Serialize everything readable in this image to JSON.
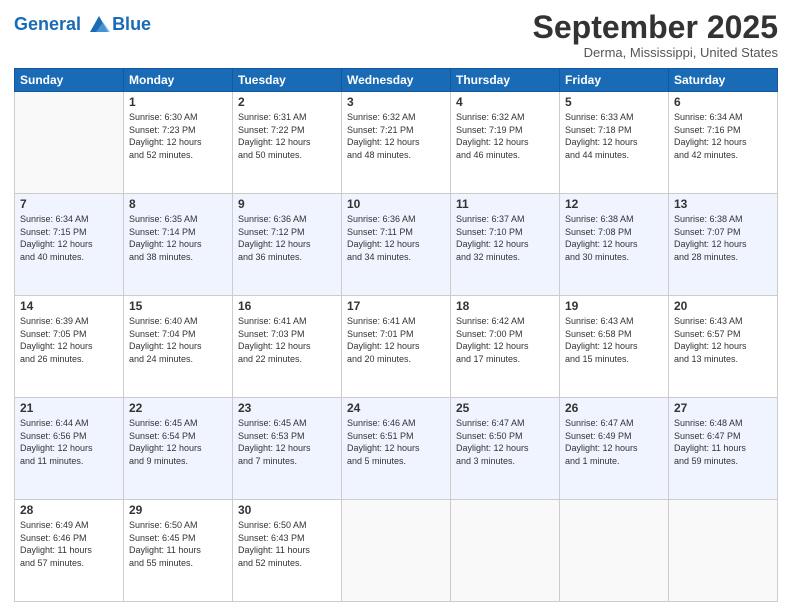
{
  "header": {
    "logo_line1": "General",
    "logo_line2": "Blue",
    "month": "September 2025",
    "location": "Derma, Mississippi, United States"
  },
  "days_of_week": [
    "Sunday",
    "Monday",
    "Tuesday",
    "Wednesday",
    "Thursday",
    "Friday",
    "Saturday"
  ],
  "weeks": [
    [
      {
        "day": "",
        "info": ""
      },
      {
        "day": "1",
        "info": "Sunrise: 6:30 AM\nSunset: 7:23 PM\nDaylight: 12 hours\nand 52 minutes."
      },
      {
        "day": "2",
        "info": "Sunrise: 6:31 AM\nSunset: 7:22 PM\nDaylight: 12 hours\nand 50 minutes."
      },
      {
        "day": "3",
        "info": "Sunrise: 6:32 AM\nSunset: 7:21 PM\nDaylight: 12 hours\nand 48 minutes."
      },
      {
        "day": "4",
        "info": "Sunrise: 6:32 AM\nSunset: 7:19 PM\nDaylight: 12 hours\nand 46 minutes."
      },
      {
        "day": "5",
        "info": "Sunrise: 6:33 AM\nSunset: 7:18 PM\nDaylight: 12 hours\nand 44 minutes."
      },
      {
        "day": "6",
        "info": "Sunrise: 6:34 AM\nSunset: 7:16 PM\nDaylight: 12 hours\nand 42 minutes."
      }
    ],
    [
      {
        "day": "7",
        "info": "Sunrise: 6:34 AM\nSunset: 7:15 PM\nDaylight: 12 hours\nand 40 minutes."
      },
      {
        "day": "8",
        "info": "Sunrise: 6:35 AM\nSunset: 7:14 PM\nDaylight: 12 hours\nand 38 minutes."
      },
      {
        "day": "9",
        "info": "Sunrise: 6:36 AM\nSunset: 7:12 PM\nDaylight: 12 hours\nand 36 minutes."
      },
      {
        "day": "10",
        "info": "Sunrise: 6:36 AM\nSunset: 7:11 PM\nDaylight: 12 hours\nand 34 minutes."
      },
      {
        "day": "11",
        "info": "Sunrise: 6:37 AM\nSunset: 7:10 PM\nDaylight: 12 hours\nand 32 minutes."
      },
      {
        "day": "12",
        "info": "Sunrise: 6:38 AM\nSunset: 7:08 PM\nDaylight: 12 hours\nand 30 minutes."
      },
      {
        "day": "13",
        "info": "Sunrise: 6:38 AM\nSunset: 7:07 PM\nDaylight: 12 hours\nand 28 minutes."
      }
    ],
    [
      {
        "day": "14",
        "info": "Sunrise: 6:39 AM\nSunset: 7:05 PM\nDaylight: 12 hours\nand 26 minutes."
      },
      {
        "day": "15",
        "info": "Sunrise: 6:40 AM\nSunset: 7:04 PM\nDaylight: 12 hours\nand 24 minutes."
      },
      {
        "day": "16",
        "info": "Sunrise: 6:41 AM\nSunset: 7:03 PM\nDaylight: 12 hours\nand 22 minutes."
      },
      {
        "day": "17",
        "info": "Sunrise: 6:41 AM\nSunset: 7:01 PM\nDaylight: 12 hours\nand 20 minutes."
      },
      {
        "day": "18",
        "info": "Sunrise: 6:42 AM\nSunset: 7:00 PM\nDaylight: 12 hours\nand 17 minutes."
      },
      {
        "day": "19",
        "info": "Sunrise: 6:43 AM\nSunset: 6:58 PM\nDaylight: 12 hours\nand 15 minutes."
      },
      {
        "day": "20",
        "info": "Sunrise: 6:43 AM\nSunset: 6:57 PM\nDaylight: 12 hours\nand 13 minutes."
      }
    ],
    [
      {
        "day": "21",
        "info": "Sunrise: 6:44 AM\nSunset: 6:56 PM\nDaylight: 12 hours\nand 11 minutes."
      },
      {
        "day": "22",
        "info": "Sunrise: 6:45 AM\nSunset: 6:54 PM\nDaylight: 12 hours\nand 9 minutes."
      },
      {
        "day": "23",
        "info": "Sunrise: 6:45 AM\nSunset: 6:53 PM\nDaylight: 12 hours\nand 7 minutes."
      },
      {
        "day": "24",
        "info": "Sunrise: 6:46 AM\nSunset: 6:51 PM\nDaylight: 12 hours\nand 5 minutes."
      },
      {
        "day": "25",
        "info": "Sunrise: 6:47 AM\nSunset: 6:50 PM\nDaylight: 12 hours\nand 3 minutes."
      },
      {
        "day": "26",
        "info": "Sunrise: 6:47 AM\nSunset: 6:49 PM\nDaylight: 12 hours\nand 1 minute."
      },
      {
        "day": "27",
        "info": "Sunrise: 6:48 AM\nSunset: 6:47 PM\nDaylight: 11 hours\nand 59 minutes."
      }
    ],
    [
      {
        "day": "28",
        "info": "Sunrise: 6:49 AM\nSunset: 6:46 PM\nDaylight: 11 hours\nand 57 minutes."
      },
      {
        "day": "29",
        "info": "Sunrise: 6:50 AM\nSunset: 6:45 PM\nDaylight: 11 hours\nand 55 minutes."
      },
      {
        "day": "30",
        "info": "Sunrise: 6:50 AM\nSunset: 6:43 PM\nDaylight: 11 hours\nand 52 minutes."
      },
      {
        "day": "",
        "info": ""
      },
      {
        "day": "",
        "info": ""
      },
      {
        "day": "",
        "info": ""
      },
      {
        "day": "",
        "info": ""
      }
    ]
  ]
}
